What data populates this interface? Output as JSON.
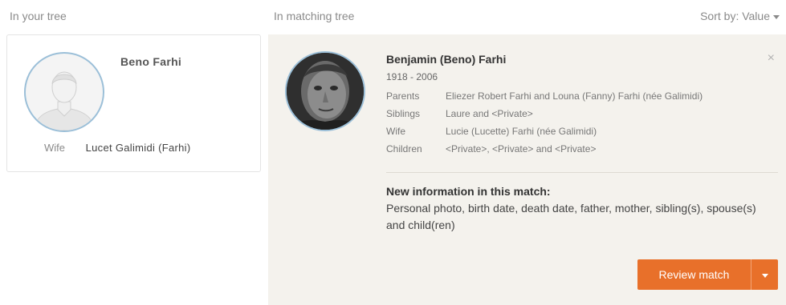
{
  "headers": {
    "your_tree": "In your tree",
    "matching_tree": "In matching tree",
    "sort_label": "Sort by: Value"
  },
  "your_tree_card": {
    "name": "Beno Farhi",
    "relation_label": "Wife",
    "relation_value": "Lucet Galimidi (Farhi)"
  },
  "match_card": {
    "name": "Benjamin (Beno) Farhi",
    "dates": "1918 - 2006",
    "facts": [
      {
        "label": "Parents",
        "value": "Eliezer Robert Farhi and Louna (Fanny) Farhi (née Galimidi)"
      },
      {
        "label": "Siblings",
        "value": "Laure and <Private>"
      },
      {
        "label": "Wife",
        "value": "Lucie (Lucette) Farhi (née Galimidi)"
      },
      {
        "label": "Children",
        "value": "<Private>, <Private> and <Private>"
      }
    ],
    "new_info_title": "New information in this match:",
    "new_info_text": "Personal photo, birth date, death date, father, mother, sibling(s), spouse(s) and child(ren)",
    "review_label": "Review match",
    "close_glyph": "×"
  },
  "colors": {
    "accent": "#e8702a",
    "avatar_border": "#9bbfd8",
    "match_bg": "#f4f2ed"
  }
}
